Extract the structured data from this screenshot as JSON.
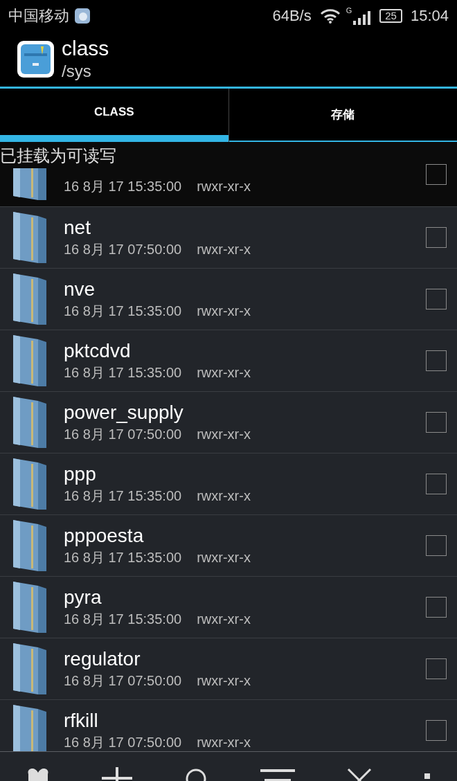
{
  "status_bar": {
    "carrier": "中国移动",
    "speed": "64B/s",
    "network": "G",
    "battery": "25",
    "time": "15:04"
  },
  "header": {
    "title": "class",
    "path": "/sys"
  },
  "tabs": [
    {
      "label": "CLASS",
      "selected": true
    },
    {
      "label": "存储",
      "selected": false
    }
  ],
  "toast": "已挂载为可读写",
  "files": [
    {
      "date": "16 8月 17 15:35:00",
      "perms": "rwxr-xr-x",
      "checked": false
    },
    {
      "name": "net",
      "date": "16 8月 17 07:50:00",
      "perms": "rwxr-xr-x",
      "checked": false
    },
    {
      "name": "nve",
      "date": "16 8月 17 15:35:00",
      "perms": "rwxr-xr-x",
      "checked": false
    },
    {
      "name": "pktcdvd",
      "date": "16 8月 17 15:35:00",
      "perms": "rwxr-xr-x",
      "checked": false
    },
    {
      "name": "power_supply",
      "date": "16 8月 17 07:50:00",
      "perms": "rwxr-xr-x",
      "checked": false
    },
    {
      "name": "ppp",
      "date": "16 8月 17 15:35:00",
      "perms": "rwxr-xr-x",
      "checked": false
    },
    {
      "name": "pppoesta",
      "date": "16 8月 17 15:35:00",
      "perms": "rwxr-xr-x",
      "checked": false
    },
    {
      "name": "pyra",
      "date": "16 8月 17 15:35:00",
      "perms": "rwxr-xr-x",
      "checked": false
    },
    {
      "name": "regulator",
      "date": "16 8月 17 07:50:00",
      "perms": "rwxr-xr-x",
      "checked": false
    },
    {
      "name": "rfkill",
      "date": "16 8月 17 07:50:00",
      "perms": "rwxr-xr-x",
      "checked": false
    }
  ]
}
